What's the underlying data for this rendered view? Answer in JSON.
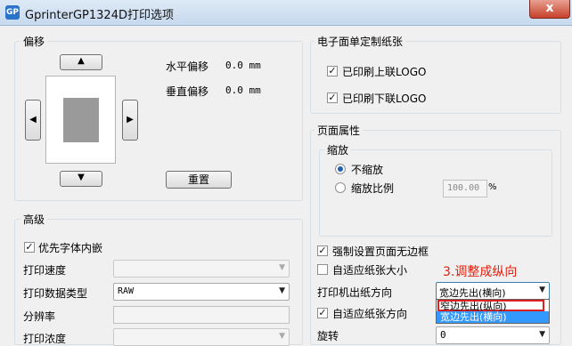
{
  "window": {
    "app_icon": "GP",
    "title": "GprinterGP1324D打印选项",
    "close_label": "x"
  },
  "offset": {
    "title": "偏移",
    "up_icon": "▲",
    "down_icon": "▼",
    "left_icon": "◀",
    "right_icon": "▶",
    "horizontal_label": "水平偏移",
    "horizontal_value": "0.0 mm",
    "vertical_label": "垂直偏移",
    "vertical_value": "0.0 mm",
    "reset_label": "重置"
  },
  "advanced": {
    "title": "高级",
    "embed_fonts_label": "优先字体内嵌",
    "embed_fonts_checked": true,
    "print_speed_label": "打印速度",
    "print_speed_value": "",
    "data_type_label": "打印数据类型",
    "data_type_value": "RAW",
    "resolution_label": "分辨率",
    "resolution_value": "",
    "density_label": "打印浓度"
  },
  "einvoice": {
    "title": "电子面单定制纸张",
    "logo_top_label": "已印刷上联LOGO",
    "logo_top_checked": true,
    "logo_bottom_label": "已印刷下联LOGO",
    "logo_bottom_checked": true
  },
  "page_props": {
    "title": "页面属性",
    "scale_group": "缩放",
    "no_scale_label": "不缩放",
    "no_scale_selected": true,
    "scale_ratio_label": "缩放比例",
    "scale_ratio_value": "100.00",
    "percent_sign": "%",
    "borderless_label": "强制设置页面无边框",
    "borderless_checked": true,
    "fit_size_label": "自适应纸张大小",
    "fit_size_checked": false,
    "annotation": "3.调整成纵向",
    "direction_label": "打印机出纸方向",
    "direction_value": "宽边先出(横向)",
    "direction_options": [
      "窄边先出(纵向)",
      "宽边先出(横向)"
    ],
    "fit_direction_label": "自适应纸张方向",
    "fit_direction_checked": true,
    "rotate_label": "旋转",
    "rotate_value": "0"
  },
  "check_mark": "✓",
  "dropdown_icon": "▼",
  "colors": {
    "annotation_red": "#e02010",
    "highlight_blue": "#3399ff",
    "red_box": "#e02020"
  }
}
